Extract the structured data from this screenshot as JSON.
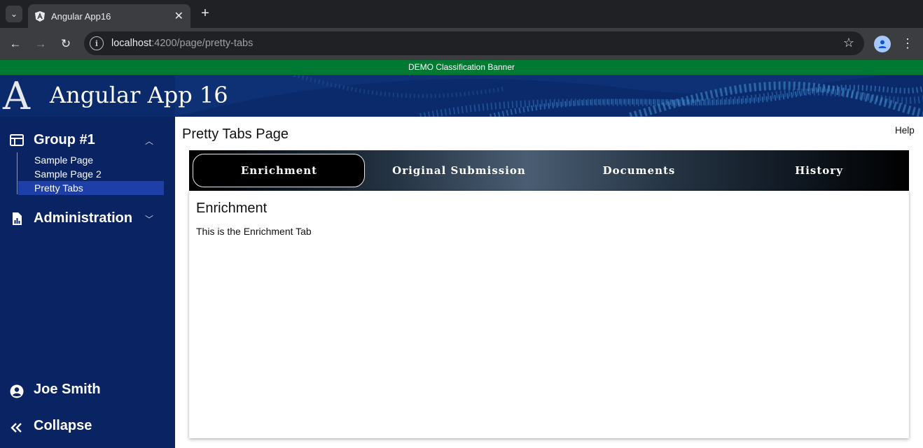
{
  "browser": {
    "tab_title": "Angular App16",
    "url_host": "localhost",
    "url_path": ":4200/page/pretty-tabs"
  },
  "banner": {
    "text": "DEMO Classification Banner",
    "color": "#007a33"
  },
  "header": {
    "logo": "A",
    "title": "Angular App 16"
  },
  "sidebar": {
    "groups": [
      {
        "label": "Group #1",
        "icon": "dashboard-icon",
        "expanded": true,
        "items": [
          {
            "label": "Sample Page",
            "active": false
          },
          {
            "label": "Sample Page 2",
            "active": false
          },
          {
            "label": "Pretty Tabs",
            "active": true
          }
        ]
      },
      {
        "label": "Administration",
        "icon": "report-icon",
        "expanded": false
      }
    ],
    "user": {
      "label": "Joe Smith",
      "icon": "account-circle-icon"
    },
    "collapse": {
      "label": "Collapse",
      "icon": "double-chevron-left-icon"
    }
  },
  "main": {
    "title": "Pretty Tabs Page",
    "help": "Help",
    "tabs": [
      {
        "label": "Enrichment",
        "active": true
      },
      {
        "label": "Original Submission",
        "active": false
      },
      {
        "label": "Documents",
        "active": false
      },
      {
        "label": "History",
        "active": false
      }
    ],
    "content": {
      "heading": "Enrichment",
      "text": "This is the Enrichment Tab"
    }
  },
  "colors": {
    "sidebar_bg": "#0a2363",
    "active_item": "#1e3fa8",
    "header_bg": "#0a2a6b"
  }
}
